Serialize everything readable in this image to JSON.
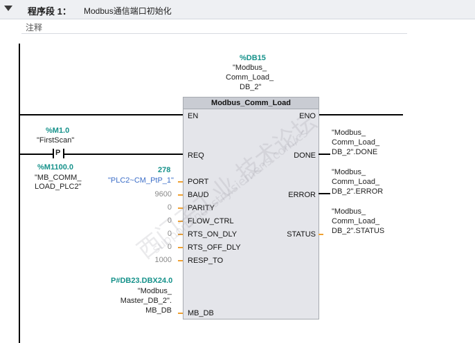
{
  "segment": {
    "title": "程序段 1：",
    "description": "Modbus通信端口初始化",
    "comment_label": "注释"
  },
  "block": {
    "db_address": "%DB15",
    "db_name_lines": [
      "\"Modbus_",
      "Comm_Load_",
      "DB_2\""
    ],
    "name": "Modbus_Comm_Load",
    "inputs": [
      {
        "pin": "EN",
        "value": ""
      },
      {
        "pin": "REQ",
        "value": ""
      },
      {
        "pin": "PORT",
        "value": "\"PLC2~CM_PtP_1\"",
        "address": "278"
      },
      {
        "pin": "BAUD",
        "value": "9600"
      },
      {
        "pin": "PARITY",
        "value": "0"
      },
      {
        "pin": "FLOW_CTRL",
        "value": "0"
      },
      {
        "pin": "RTS_ON_DLY",
        "value": "0"
      },
      {
        "pin": "RTS_OFF_DLY",
        "value": "0"
      },
      {
        "pin": "RESP_TO",
        "value": "1000"
      },
      {
        "pin": "MB_DB",
        "value": ""
      }
    ],
    "outputs": [
      {
        "pin": "ENO",
        "tag_lines": []
      },
      {
        "pin": "DONE",
        "tag_lines": [
          "\"Modbus_",
          "Comm_Load_",
          "DB_2\".DONE"
        ]
      },
      {
        "pin": "ERROR",
        "tag_lines": [
          "\"Modbus_",
          "Comm_Load_",
          "DB_2\".ERROR"
        ]
      },
      {
        "pin": "STATUS",
        "tag_lines": [
          "\"Modbus_",
          "Comm_Load_",
          "DB_2\".STATUS"
        ]
      }
    ]
  },
  "contact": {
    "address": "%M1.0",
    "tag": "\"FirstScan\"",
    "symbol": "P",
    "edge_address": "%M1100.0",
    "edge_tag_lines": [
      "\"MB_COMM_",
      "LOAD_PLC2\""
    ]
  },
  "mb_db": {
    "address": "P#DB23.DBX24.0",
    "tag_lines": [
      "\"Modbus_",
      "Master_DB_2\".",
      "MB_DB"
    ]
  },
  "watermark": {
    "line1": "西门子工业 技术论坛",
    "line2": "support.industry.siemens.com/cs"
  },
  "colors": {
    "db_address": "#15918a",
    "port_value": "#3c6ec8",
    "pin_stub": "#f0a030"
  }
}
